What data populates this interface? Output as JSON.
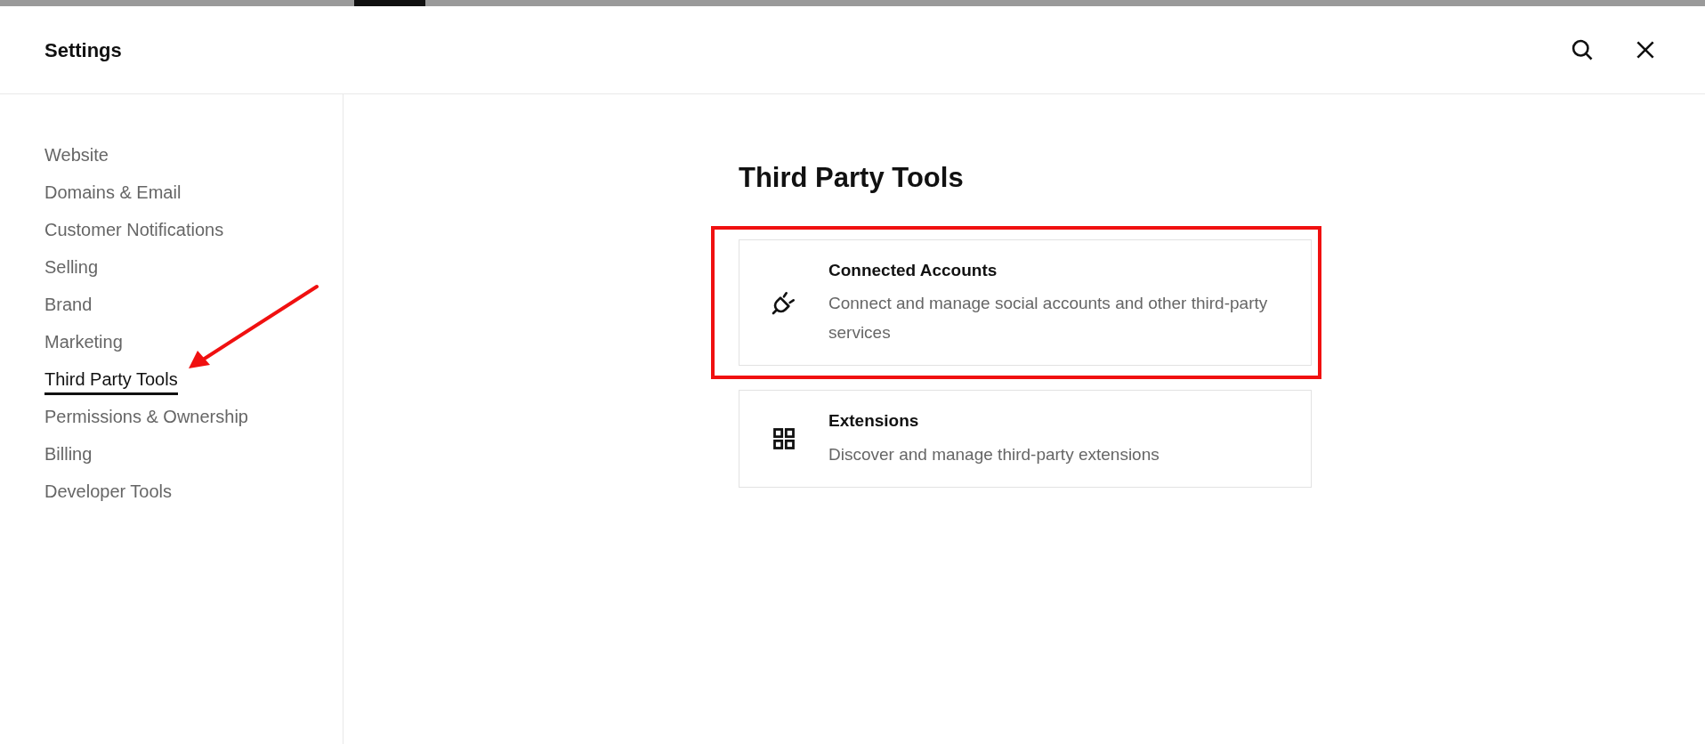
{
  "header": {
    "title": "Settings"
  },
  "sidebar": {
    "items": [
      {
        "label": "Website",
        "selected": false
      },
      {
        "label": "Domains & Email",
        "selected": false
      },
      {
        "label": "Customer Notifications",
        "selected": false
      },
      {
        "label": "Selling",
        "selected": false
      },
      {
        "label": "Brand",
        "selected": false
      },
      {
        "label": "Marketing",
        "selected": false
      },
      {
        "label": "Third Party Tools",
        "selected": true
      },
      {
        "label": "Permissions & Ownership",
        "selected": false
      },
      {
        "label": "Billing",
        "selected": false
      },
      {
        "label": "Developer Tools",
        "selected": false
      }
    ]
  },
  "main": {
    "heading": "Third Party Tools",
    "cards": [
      {
        "kind": "plug",
        "title": "Connected Accounts",
        "description": "Connect and manage social accounts and other third-party services",
        "highlighted": true
      },
      {
        "kind": "grid",
        "title": "Extensions",
        "description": "Discover and manage third-party extensions",
        "highlighted": false
      }
    ]
  }
}
